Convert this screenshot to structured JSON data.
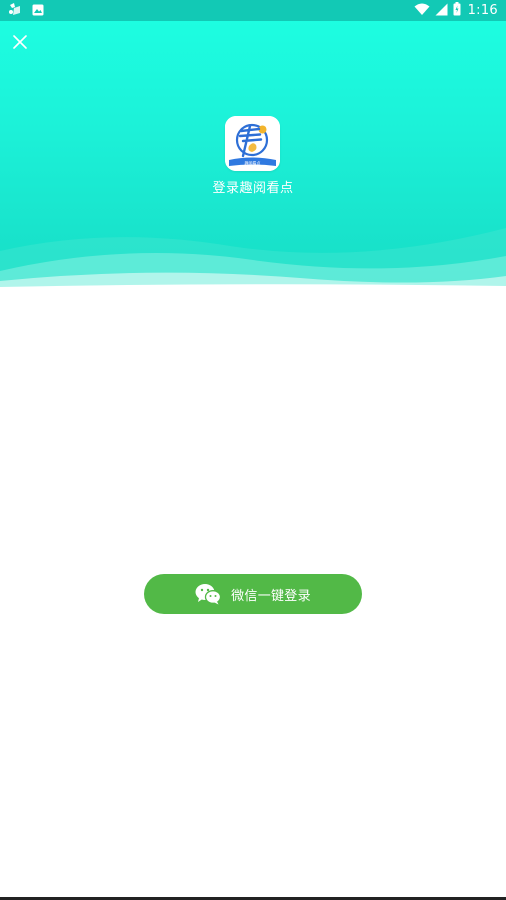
{
  "status_bar": {
    "time": "1:16",
    "icons": [
      "photo-icon",
      "image-icon",
      "wifi-icon",
      "cell-signal-icon",
      "battery-icon"
    ]
  },
  "header": {
    "title": "登录趣阅看点",
    "close_icon": "close-icon",
    "logo": {
      "glyph": "看",
      "caption": "趣阅看点",
      "colors": {
        "glyph": "#2d6fd6",
        "coin": "#f3b42b",
        "band": "#2f79e0"
      }
    }
  },
  "login": {
    "wechat_label": "微信一键登录",
    "icon": "wechat-icon"
  },
  "colors": {
    "status_bar": "#12c9b5",
    "header_top": "#1dfde1",
    "header_bottom": "#17dcc5",
    "button": "#52b947",
    "background": "#ffffff"
  }
}
